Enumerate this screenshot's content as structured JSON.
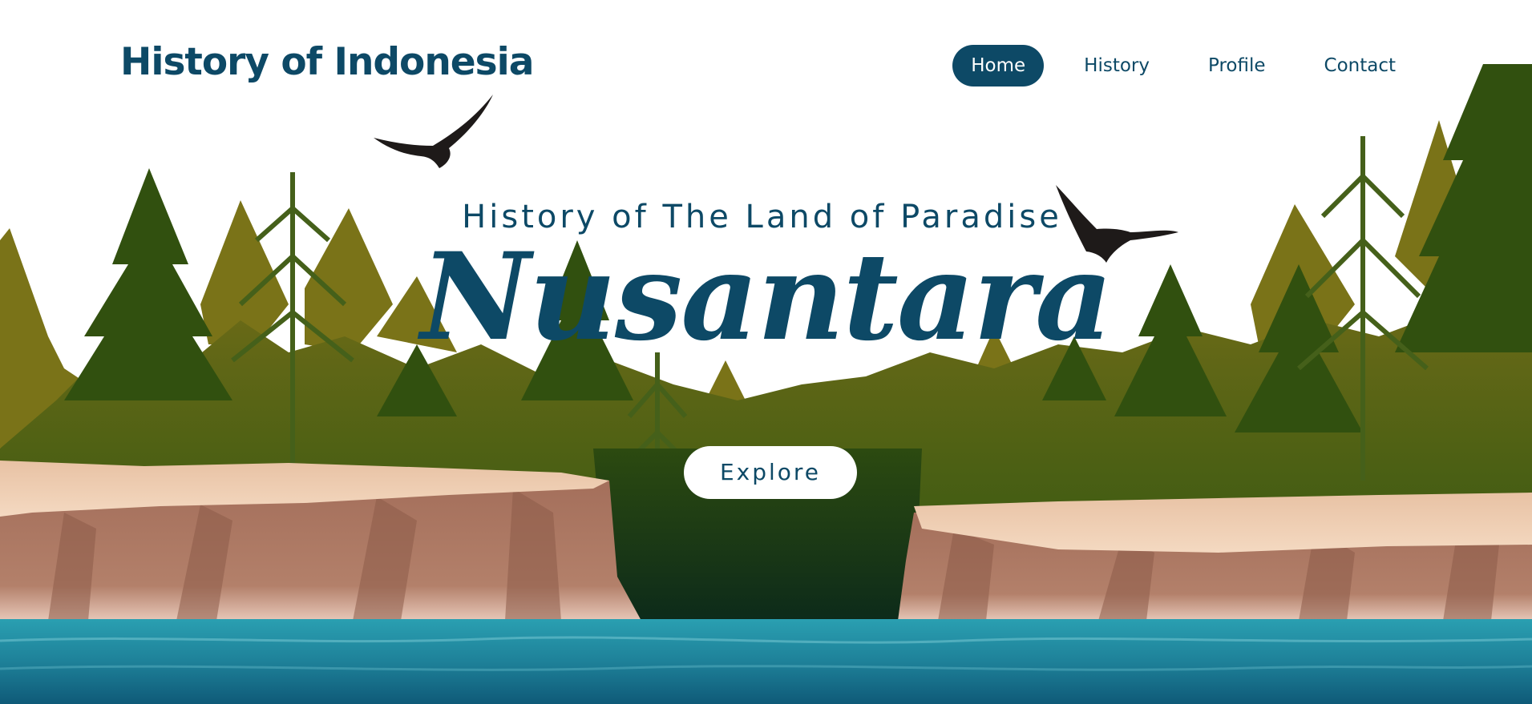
{
  "brand": {
    "name": "History of Indonesia"
  },
  "nav": {
    "items": [
      {
        "label": "Home",
        "active": true
      },
      {
        "label": "History",
        "active": false
      },
      {
        "label": "Profile",
        "active": false
      },
      {
        "label": "Contact",
        "active": false
      }
    ]
  },
  "hero": {
    "subtitle": "History of The Land of Paradise",
    "title": "Nusantara",
    "cta_label": "Explore"
  },
  "illustration": {
    "elements": [
      "eagle-icon",
      "eagle-icon",
      "pine-forest",
      "cliffs",
      "sea-water"
    ]
  },
  "colors": {
    "primary": "#0d4966",
    "forest_light": "#7a7318",
    "forest_dark": "#2f4a12",
    "cliff_top": "#eec9a9",
    "cliff_face": "#a8735e",
    "water": "#1a8a9e"
  }
}
